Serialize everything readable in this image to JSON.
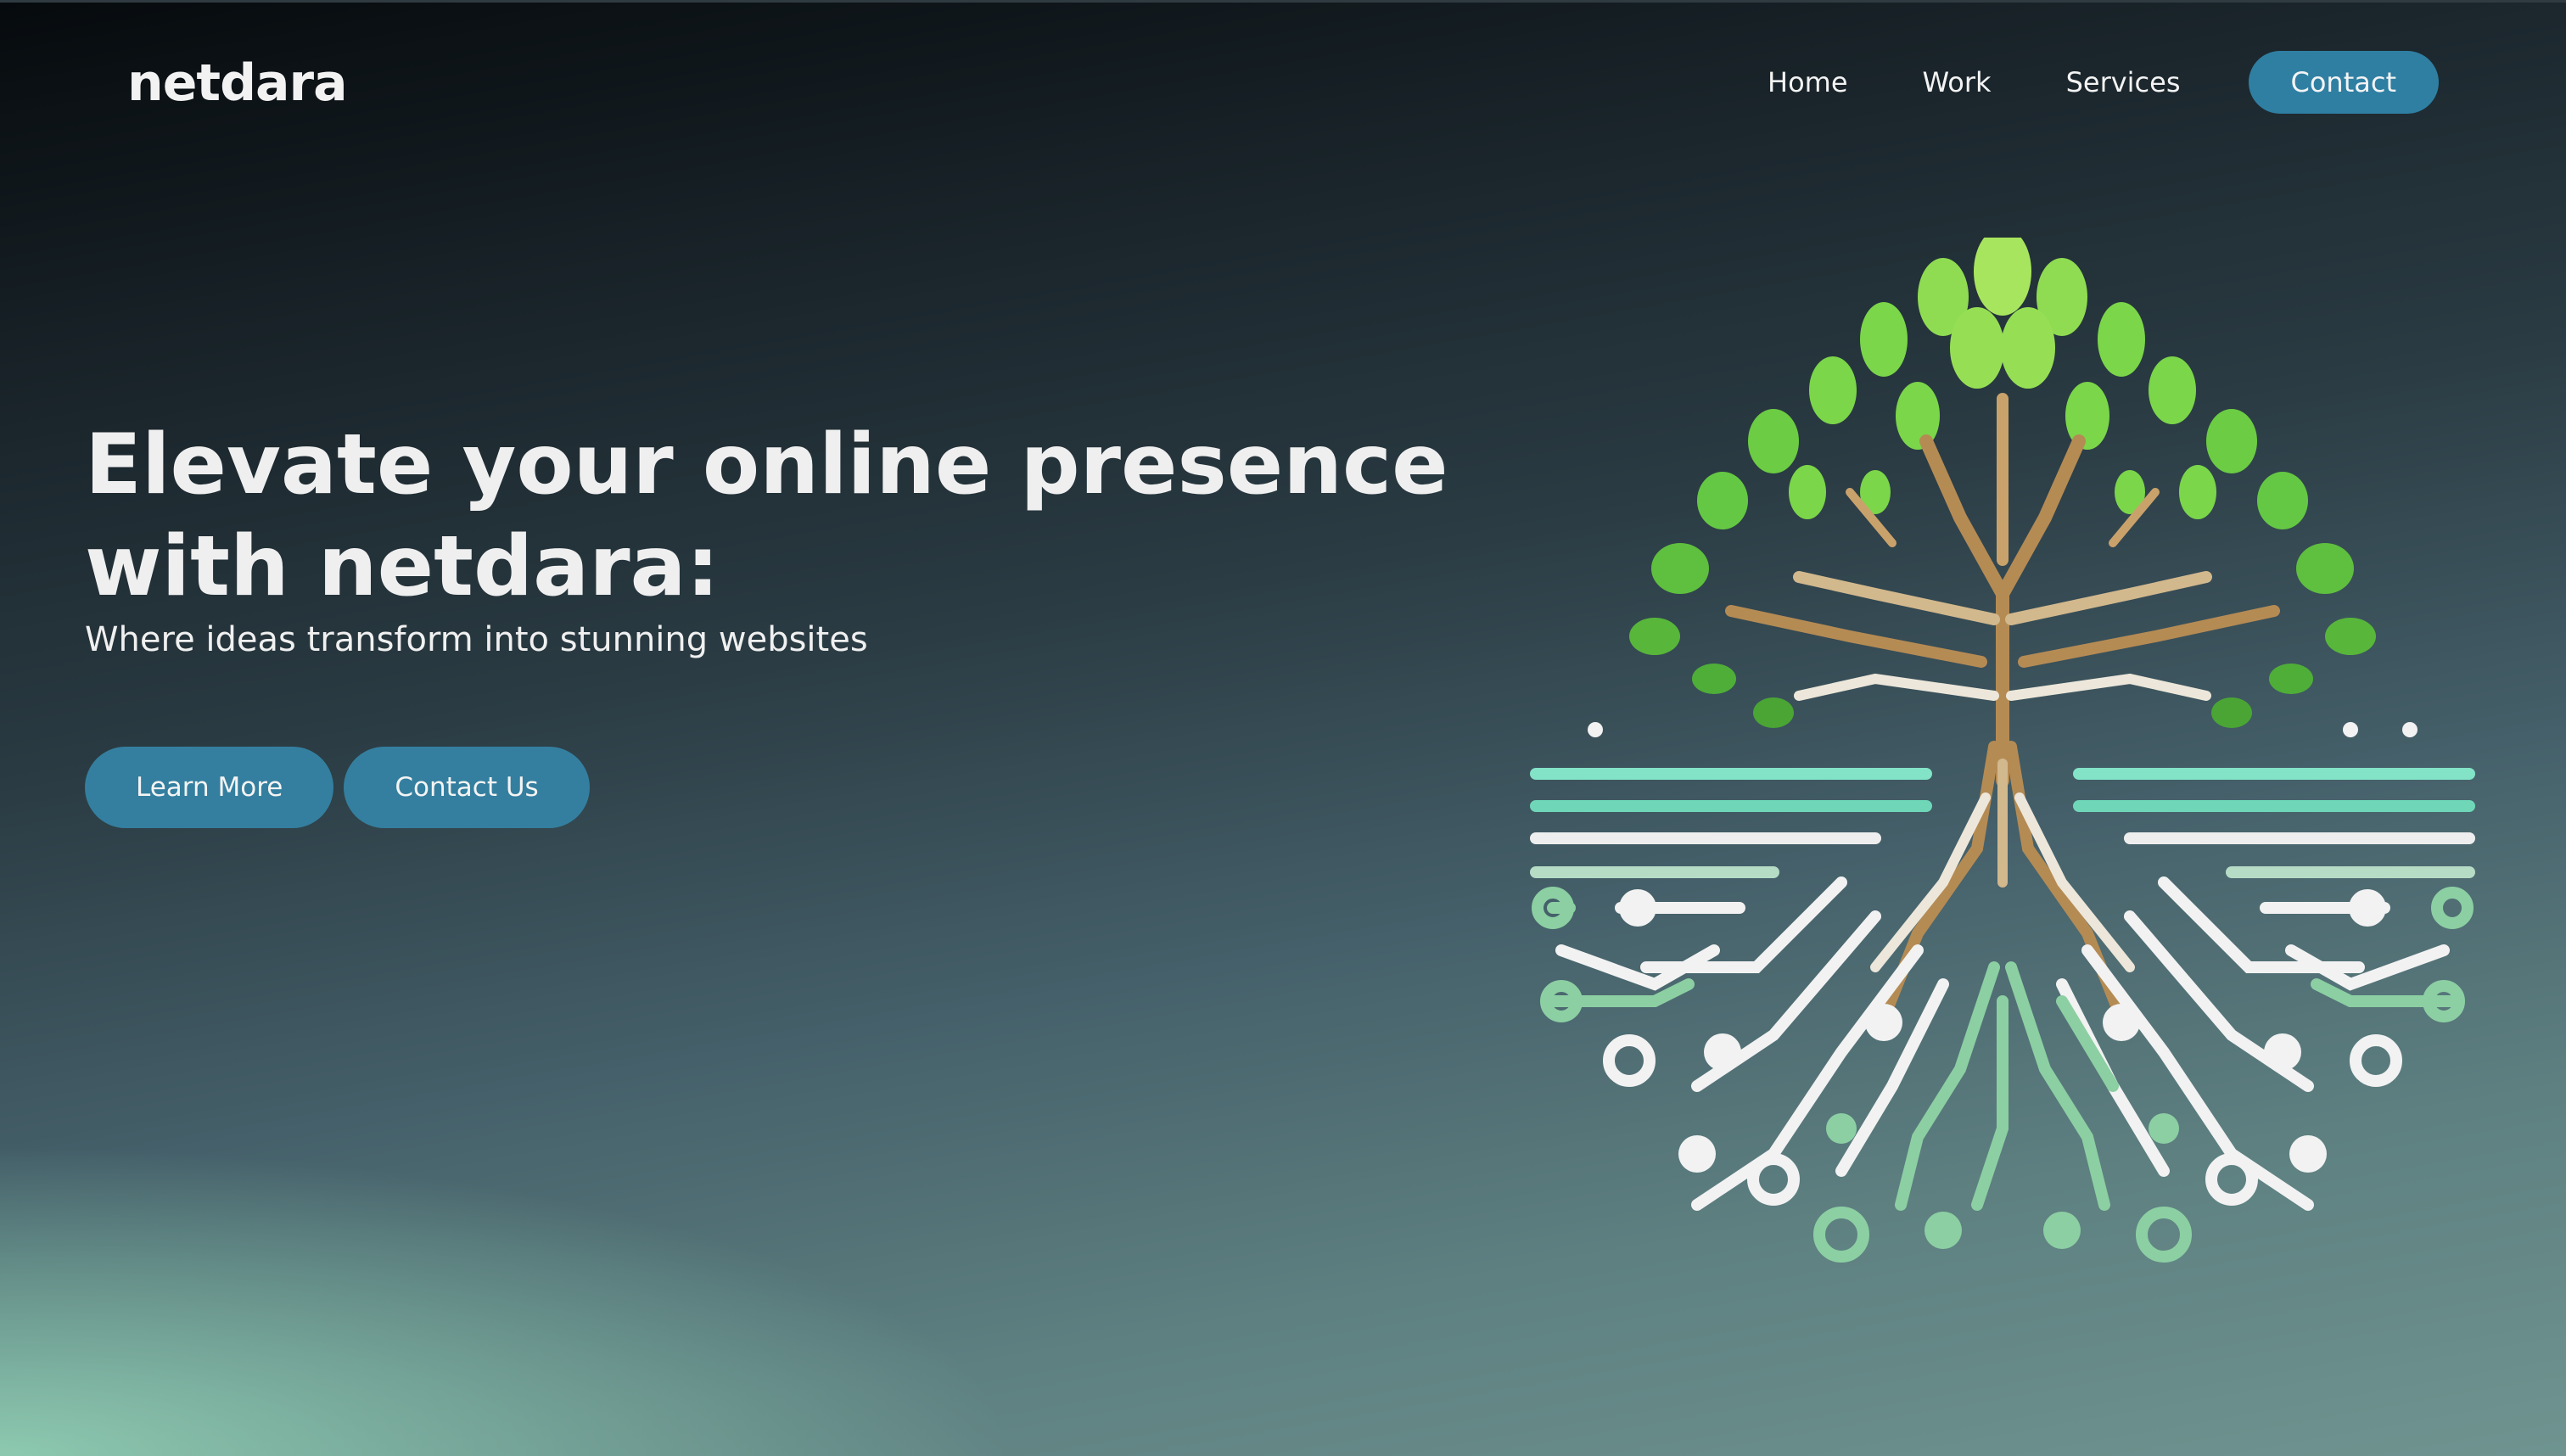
{
  "brand": {
    "logo_text": "netdara"
  },
  "nav": {
    "items": [
      {
        "label": "Home"
      },
      {
        "label": "Work"
      },
      {
        "label": "Services"
      }
    ],
    "cta_label": "Contact"
  },
  "hero": {
    "title_line1": "Elevate your online presence",
    "title_line2": "with netdara:",
    "subtitle": "Where ideas transform into stunning websites",
    "primary_button": "Learn More",
    "secondary_button": "Contact Us"
  },
  "colors": {
    "accent": "#347f9f",
    "leaf_green": "#7bd64a",
    "root_brown": "#b58b54",
    "circuit_mint": "#7fe0c0",
    "text": "#f4f4f4"
  },
  "icons": {
    "illustration": "tree-circuit-illustration"
  }
}
